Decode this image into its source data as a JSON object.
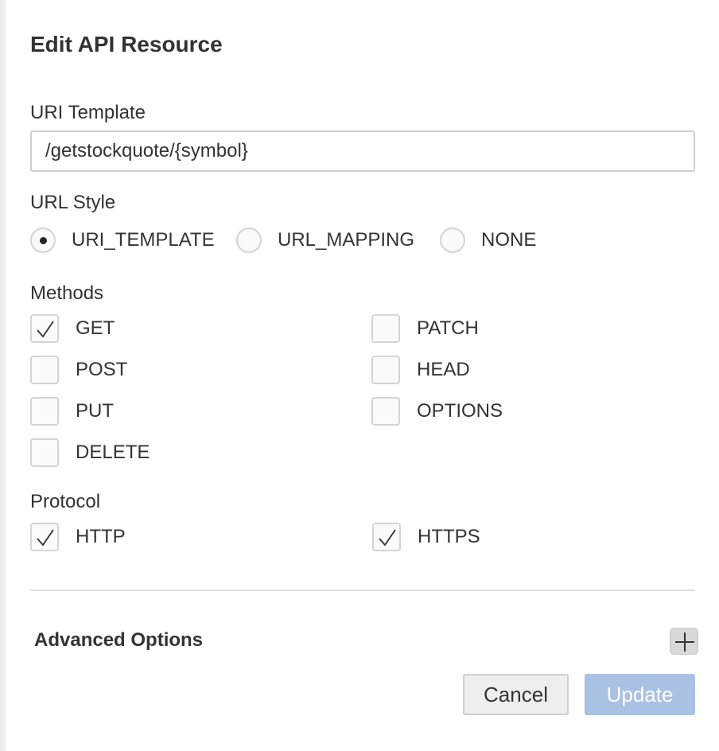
{
  "dialog": {
    "title": "Edit API Resource"
  },
  "uri_template": {
    "label": "URI Template",
    "value": "/getstockquote/{symbol}"
  },
  "url_style": {
    "label": "URL Style",
    "options": [
      {
        "label": "URI_TEMPLATE",
        "selected": true
      },
      {
        "label": "URL_MAPPING",
        "selected": false
      },
      {
        "label": "NONE",
        "selected": false
      }
    ]
  },
  "methods": {
    "label": "Methods",
    "items": [
      {
        "label": "GET",
        "checked": true
      },
      {
        "label": "POST",
        "checked": false
      },
      {
        "label": "PUT",
        "checked": false
      },
      {
        "label": "DELETE",
        "checked": false
      },
      {
        "label": "PATCH",
        "checked": false
      },
      {
        "label": "HEAD",
        "checked": false
      },
      {
        "label": "OPTIONS",
        "checked": false
      }
    ]
  },
  "protocol": {
    "label": "Protocol",
    "items": [
      {
        "label": "HTTP",
        "checked": true
      },
      {
        "label": "HTTPS",
        "checked": true
      }
    ]
  },
  "advanced": {
    "title": "Advanced Options",
    "expand_icon": "plus-icon"
  },
  "footer": {
    "cancel_label": "Cancel",
    "update_label": "Update",
    "update_color": "#a9c1e2"
  }
}
